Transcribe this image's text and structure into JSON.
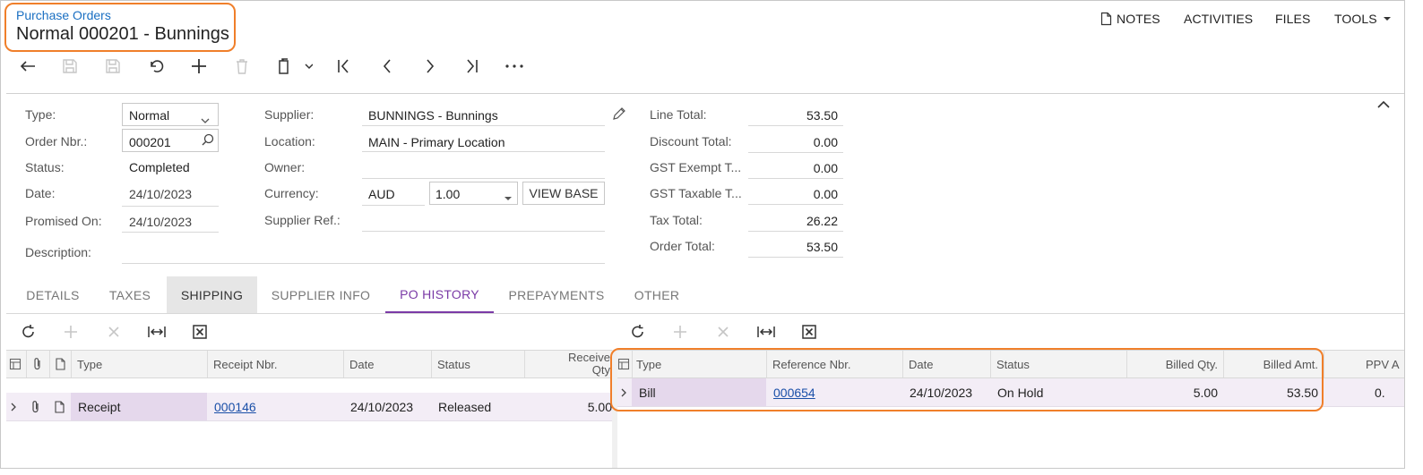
{
  "header": {
    "breadcrumb": "Purchase Orders",
    "title": "Normal 000201 - Bunnings",
    "menu": {
      "notes": "NOTES",
      "activities": "ACTIVITIES",
      "files": "FILES",
      "tools": "TOOLS"
    }
  },
  "form": {
    "type_label": "Type:",
    "type_value": "Normal",
    "order_label": "Order Nbr.:",
    "order_value": "000201",
    "status_label": "Status:",
    "status_value": "Completed",
    "date_label": "Date:",
    "date_value": "24/10/2023",
    "promised_label": "Promised On:",
    "promised_value": "24/10/2023",
    "description_label": "Description:",
    "supplier_label": "Supplier:",
    "supplier_value": "BUNNINGS - Bunnings",
    "location_label": "Location:",
    "location_value": "MAIN - Primary Location",
    "owner_label": "Owner:",
    "currency_label": "Currency:",
    "currency_value": "AUD",
    "rate_value": "1.00",
    "view_base": "VIEW BASE",
    "supplier_ref_label": "Supplier Ref.:"
  },
  "totals": [
    {
      "label": "Line Total:",
      "value": "53.50"
    },
    {
      "label": "Discount Total:",
      "value": "0.00"
    },
    {
      "label": "GST Exempt T...",
      "value": "0.00"
    },
    {
      "label": "GST Taxable T...",
      "value": "0.00"
    },
    {
      "label": "Tax Total:",
      "value": "26.22"
    },
    {
      "label": "Order Total:",
      "value": "53.50"
    }
  ],
  "tabs": [
    "DETAILS",
    "TAXES",
    "SHIPPING",
    "SUPPLIER INFO",
    "PO HISTORY",
    "PREPAYMENTS",
    "OTHER"
  ],
  "left_grid": {
    "headers": {
      "type": "Type",
      "receipt": "Receipt Nbr.",
      "date": "Date",
      "status": "Status",
      "received": "Receive",
      "received2": "Qty"
    },
    "row": {
      "type": "Receipt",
      "receipt": "000146",
      "date": "24/10/2023",
      "status": "Released",
      "received": "5.00"
    }
  },
  "right_grid": {
    "headers": {
      "type": "Type",
      "ref": "Reference Nbr.",
      "date": "Date",
      "status": "Status",
      "billed_qty": "Billed Qty.",
      "billed_amt": "Billed Amt.",
      "ppv": "PPV A"
    },
    "row": {
      "type": "Bill",
      "ref": "000654",
      "date": "24/10/2023",
      "status": "On Hold",
      "billed_qty": "5.00",
      "billed_amt": "53.50",
      "ppv": "0."
    }
  },
  "colors": {
    "accent": "#7a3aa6",
    "link": "#1a6fc2",
    "highlight": "#f07f2a",
    "row_bg": "#f3edf6"
  }
}
